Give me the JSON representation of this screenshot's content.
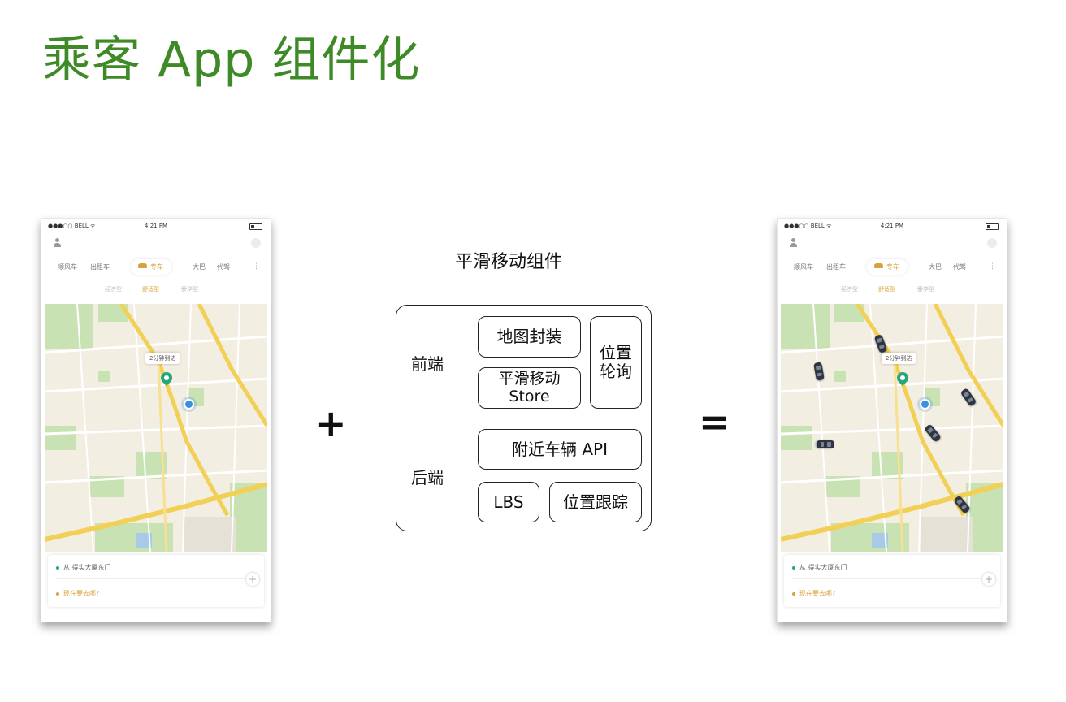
{
  "title": "乘客 App 组件化",
  "phone": {
    "status_carrier": "●●●○○ BELL ᯤ",
    "status_time": "4:21 PM",
    "tabs": [
      "顺风车",
      "出租车",
      "专车",
      "大巴",
      "代驾"
    ],
    "more": "⋮",
    "sub_tabs": [
      "经济型",
      "舒适型",
      "豪华型"
    ],
    "map_callout": "2分钟到达",
    "from_text": "从 得实大厦东门",
    "to_text": "现在要去哪?",
    "plus": "+"
  },
  "operators": {
    "plus": "+",
    "equals": "="
  },
  "component": {
    "title": "平滑移动组件",
    "frontend_label": "前端",
    "backend_label": "后端",
    "map_wrapper": "地图封装",
    "smooth_store_line1": "平滑移动",
    "smooth_store_line2": "Store",
    "position_poll_line1": "位置",
    "position_poll_line2": "轮询",
    "nearby_api": "附近车辆 API",
    "lbs": "LBS",
    "position_tracking": "位置跟踪"
  },
  "colors": {
    "title_green": "#3d8a26",
    "accent_orange": "#d9a23b",
    "map_green": "#c9e2b4",
    "road_yellow": "#f2cf55"
  }
}
